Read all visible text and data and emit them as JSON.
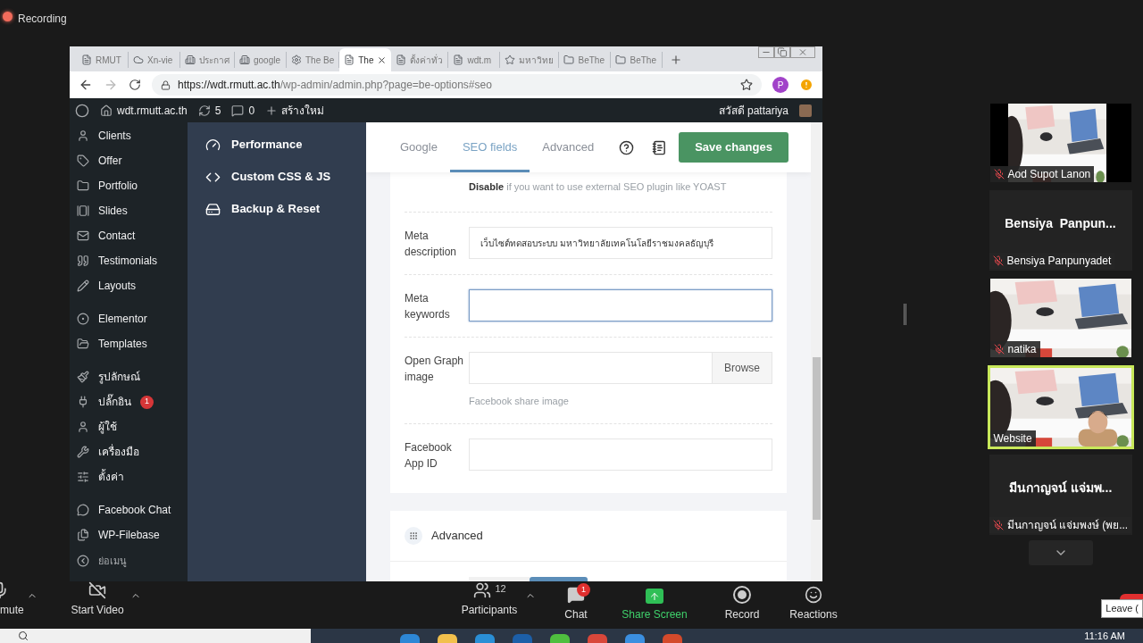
{
  "recording": {
    "label": "Recording"
  },
  "browser": {
    "tabs": [
      {
        "label": "RMUT",
        "selected": false
      },
      {
        "label": "Xn-vie",
        "selected": false
      },
      {
        "label": "ประกาศ",
        "selected": false
      },
      {
        "label": "google",
        "selected": false
      },
      {
        "label": "The Be",
        "selected": false
      },
      {
        "label": "The",
        "selected": true
      },
      {
        "label": "ตั้งค่าทั่ว",
        "selected": false
      },
      {
        "label": "wdt.m",
        "selected": false
      },
      {
        "label": "มหาวิทย",
        "selected": false
      },
      {
        "label": "BeThe",
        "selected": false
      },
      {
        "label": "BeThe",
        "selected": false
      }
    ],
    "url_host": "https://wdt.rmutt.ac.th",
    "url_path": "/wp-admin/admin.php?page=be-options#seo",
    "profile_initial": "P"
  },
  "admin_bar": {
    "site": "wdt.rmutt.ac.th",
    "updates": "5",
    "comments": "0",
    "new": "สร้างใหม่",
    "greeting": "สวัสดี pattariya"
  },
  "wp_menu_groups": [
    {
      "items": [
        {
          "label": "Clients"
        },
        {
          "label": "Offer"
        },
        {
          "label": "Portfolio"
        },
        {
          "label": "Slides"
        },
        {
          "label": "Contact"
        },
        {
          "label": "Testimonials"
        },
        {
          "label": "Layouts"
        }
      ]
    },
    {
      "items": [
        {
          "label": "Elementor"
        },
        {
          "label": "Templates"
        }
      ]
    },
    {
      "items": [
        {
          "label": "รูปลักษณ์"
        },
        {
          "label": "ปลั๊กอิน",
          "badge": "1"
        },
        {
          "label": "ผู้ใช้"
        },
        {
          "label": "เครื่องมือ"
        },
        {
          "label": "ตั้งค่า"
        }
      ]
    },
    {
      "items": [
        {
          "label": "Facebook Chat"
        },
        {
          "label": "WP-Filebase"
        }
      ]
    }
  ],
  "collapse_menu": "ย่อเมนู",
  "options_nav": [
    "Performance",
    "Custom CSS & JS",
    "Backup & Reset"
  ],
  "tabs": [
    {
      "label": "Google",
      "selected": false
    },
    {
      "label": "SEO fields",
      "selected": true
    },
    {
      "label": "Advanced",
      "selected": false
    }
  ],
  "save_button": "Save changes",
  "seo_note": "**Disable** if you want to use external SEO plugin like YOAST",
  "fields": [
    {
      "kind": "text",
      "label": "Meta description",
      "value": "เว็บไซต์ทดสอบระบบ มหาวิทยาลัยเทคโนโลยีราชมงคลธัญบุรี",
      "focused": false
    },
    {
      "kind": "text",
      "label": "Meta keywords",
      "focused": true
    },
    {
      "kind": "file",
      "label": "Open Graph image",
      "button": "Browse",
      "hint": "Facebook share image",
      "focused": false
    },
    {
      "kind": "text",
      "label": "Facebook App ID",
      "focused": false
    }
  ],
  "advanced_section": {
    "title": "Advanced"
  },
  "participants": [
    {
      "kind": "video",
      "name": "Aod Supot Lanon",
      "muted": true,
      "speaking": false,
      "person": false,
      "letterbox": true
    },
    {
      "kind": "name",
      "display": "Bensiya  Panpun...",
      "name": "Bensiya Panpunyadet",
      "muted": true
    },
    {
      "kind": "video",
      "name": "natika",
      "muted": true,
      "speaking": false,
      "person": false,
      "letterbox": false
    },
    {
      "kind": "video",
      "name": "Website",
      "muted": false,
      "speaking": true,
      "person": true,
      "letterbox": false
    },
    {
      "kind": "name",
      "display": "มีนกาญจน์ แจ่มพ...",
      "name": "มีนกาญจน์ แจ่มพงษ์ (พย...",
      "muted": true
    }
  ],
  "toolbar": [
    {
      "kind": "mute",
      "label": "mute"
    },
    {
      "kind": "video",
      "label": "Start Video"
    },
    {
      "kind": "participants",
      "label": "Participants",
      "count": "12"
    },
    {
      "kind": "chat",
      "label": "Chat",
      "badge": "1"
    },
    {
      "kind": "share",
      "label": "Share Screen"
    },
    {
      "kind": "record",
      "label": "Record"
    },
    {
      "kind": "reactions",
      "label": "Reactions"
    }
  ],
  "leave_tooltip": "Leave (",
  "clock": "11:16 AM"
}
